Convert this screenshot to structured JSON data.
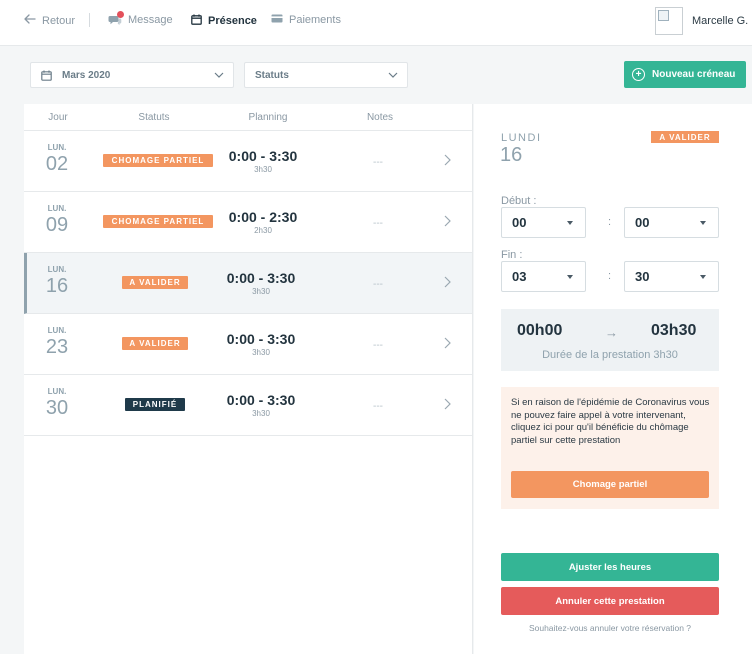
{
  "nav": {
    "back_label": "Retour",
    "message_label": "Message",
    "presence_label": "Présence",
    "payments_label": "Paiements",
    "user_name": "Marcelle G."
  },
  "filters": {
    "month_label": "Mars 2020",
    "status_label": "Statuts",
    "new_slot_label": "Nouveau créneau",
    "new_slot_icon": "+"
  },
  "table": {
    "headers": {
      "day": "Jour",
      "status": "Statuts",
      "planning": "Planning",
      "notes": "Notes"
    },
    "rows": [
      {
        "day_abbr": "LUN.",
        "day_num": "02",
        "status": "CHOMAGE PARTIEL",
        "time": "0:00 - 3:30",
        "duration": "3h30",
        "notes": "---"
      },
      {
        "day_abbr": "LUN.",
        "day_num": "09",
        "status": "CHOMAGE PARTIEL",
        "time": "0:00 - 2:30",
        "duration": "2h30",
        "notes": "---"
      },
      {
        "day_abbr": "LUN.",
        "day_num": "16",
        "status": "A VALIDER",
        "time": "0:00 - 3:30",
        "duration": "3h30",
        "notes": "---"
      },
      {
        "day_abbr": "LUN.",
        "day_num": "23",
        "status": "A VALIDER",
        "time": "0:00 - 3:30",
        "duration": "3h30",
        "notes": "---"
      },
      {
        "day_abbr": "LUN.",
        "day_num": "30",
        "status": "PLANIFIÉ",
        "time": "0:00 - 3:30",
        "duration": "3h30",
        "notes": "---"
      }
    ]
  },
  "panel": {
    "weekday": "LUNDI",
    "day_num": "16",
    "badge": "A VALIDER",
    "start_label": "Début :",
    "start_hour": "00",
    "start_min": "00",
    "end_label": "Fin :",
    "end_hour": "03",
    "end_min": "30",
    "colon": ":",
    "summary_start": "00h00",
    "summary_arrow": "→",
    "summary_end": "03h30",
    "summary_duration": "Durée de la prestation 3h30",
    "alert_text": "Si en raison de l'épidémie de Coronavirus vous ne pouvez faire appel à votre intervenant, cliquez ici pour qu'il bénéficie du chômage partiel sur cette prestation",
    "chomage_button": "Chomage partiel",
    "adjust_button": "Ajuster les heures",
    "cancel_button": "Annuler cette prestation",
    "cancel_link": "Souhaitez-vous annuler votre réservation ?"
  },
  "colors": {
    "green": "#34b595",
    "orange": "#f39660",
    "red": "#e55b5b",
    "navy": "#1f3a4a"
  }
}
